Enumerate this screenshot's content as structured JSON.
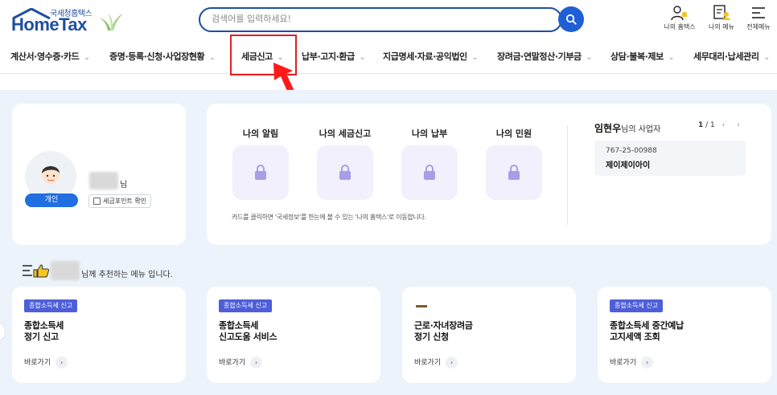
{
  "brand": {
    "sub_title": "국세청홈택스",
    "main_title": "HomeTax",
    "color": "#1f4fa0"
  },
  "search": {
    "placeholder": "검색어를 입력하세요!"
  },
  "utility": [
    {
      "label": "나의 홈택스",
      "icon": "user-bell-icon"
    },
    {
      "label": "나의 메뉴",
      "icon": "user-doc-icon"
    },
    {
      "label": "전체메뉴",
      "icon": "hamburger-icon"
    }
  ],
  "nav": [
    "계산서·영수증·카드",
    "증명·등록·신청·사업장현황",
    "세금신고",
    "납부·고지·환급",
    "지급명세·자료·공익법인",
    "장려금·연말정산·기부금",
    "상담·불복·제보",
    "세무대리·납세관리"
  ],
  "profile": {
    "suffix": "님",
    "badge": "개인",
    "taxpoint_label": "세금포인트 확인"
  },
  "dashboard": {
    "tiles": [
      "나의 알림",
      "나의 세금신고",
      "나의 납부",
      "나의 민원"
    ],
    "note": "카드를 클릭하면 '국세정보'를 한눈에 볼 수 있는 '나의 홈택스'로 이동합니다.",
    "business": {
      "owner": "임현우",
      "owner_suffix": "님의 사업자",
      "page_current": "1",
      "page_total": "/ 1",
      "number": "767-25-00988",
      "name": "제이제이아이"
    }
  },
  "recommend": {
    "suffix": "님께 추천하는 메뉴 입니다.",
    "go_label": "바로가기",
    "cards": [
      {
        "tag": "종합소득세 신고",
        "title": "종합소득세\n정기 신고"
      },
      {
        "tag": "종합소득세 신고",
        "title": "종합소득세\n신고도움 서비스"
      },
      {
        "tag": "",
        "title": "근로·자녀장려금\n정기 신청"
      },
      {
        "tag": "종합소득세 신고",
        "title": "종합소득세 중간예납\n고지세액 조회"
      }
    ]
  }
}
